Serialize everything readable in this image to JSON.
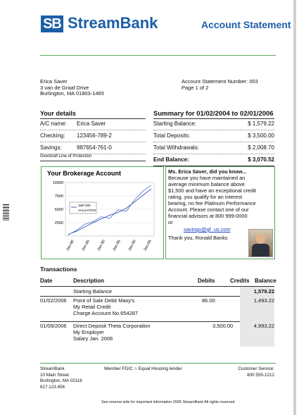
{
  "header": {
    "logo_mark": "SB",
    "logo_text": "StreamBank",
    "doc_title": "Account Statement"
  },
  "customer": {
    "name": "Erica Saver",
    "address1": "3 van de Graaf Drive",
    "address2": "Burlington, MA 01803-1465"
  },
  "statement": {
    "number_label": "Account Statement Number:",
    "number": "003",
    "page": "Page 1 of 2"
  },
  "details": {
    "title": "Your details",
    "rows": [
      {
        "label": "A/C name:",
        "value": "Erica Saver"
      },
      {
        "label": "Checking:",
        "value": "123456-789-2"
      },
      {
        "label": "Savings:",
        "value": "987654-761-0"
      }
    ],
    "overdraft": "Overdraft Line of Protection"
  },
  "summary": {
    "title": "Summary for 01/02/2004 to 02/01/2006",
    "rows": [
      {
        "label": "Starting Balance:",
        "value": "$ 1,579.22"
      },
      {
        "label": "Total Deposits:",
        "value": "$ 3,500.00"
      },
      {
        "label": "Total Withdrawals:",
        "value": "$ 2,008.70"
      }
    ],
    "end_label": "End Balance:",
    "end_value": "$ 3,070.52"
  },
  "chart_data": {
    "type": "line",
    "title": "Your Brokerage Account",
    "legend": [
      "S&P 500",
      "VALUATION"
    ],
    "ylim": [
      0,
      10000
    ],
    "yticks": [
      "10000",
      "7500",
      "5000",
      "2500"
    ],
    "xticks": [
      "Jan-80",
      "Jan-85",
      "Jan-90",
      "Jan-95",
      "Jan-00",
      "Jan-05"
    ],
    "series": [
      {
        "name": "S&P 500",
        "values": [
          300,
          900,
          1700,
          2500,
          3200,
          3900,
          4400,
          5200,
          6400,
          7600,
          8800
        ]
      },
      {
        "name": "VALUATION",
        "values": [
          200,
          1100,
          2200,
          2700,
          3600,
          3300,
          4900,
          4600,
          6800,
          8400,
          9500
        ]
      }
    ]
  },
  "promo": {
    "title": "Ms. Erica Saver, did you know...",
    "lines": [
      "Because you have maintained an",
      "average minimum balance above",
      "$1,500 and have an exceptional credit",
      "rating, you qualify for an interest",
      "bearing, no fee Platinum Performance",
      "Account. Please contact one of our",
      "financial advisors at 800 999-0000",
      "or"
    ],
    "email": "savings@gf_us.com",
    "thanks": "Thank you, Ronald Banks"
  },
  "transactions": {
    "title": "Transactions",
    "headers": {
      "date": "Date",
      "desc": "Description",
      "debits": "Debits",
      "credits": "Credits",
      "balance": "Balance"
    },
    "rows": [
      {
        "date": "",
        "desc": [
          "Starting Balance"
        ],
        "debits": "",
        "credits": "",
        "balance": "1,579.22",
        "bold": true
      },
      {
        "date": "01/02/2006",
        "desc": [
          "Point of Sale Debit Maxy's",
          "My Retail Credit",
          "Charge Account No.654287"
        ],
        "debits": "86.00",
        "credits": "",
        "balance": "1,493.22"
      },
      {
        "date": "01/09/2006",
        "desc": [
          "Direct Deposit Theta Corporation",
          "My Employer",
          "Salary  Jan. 2006"
        ],
        "debits": "",
        "credits": "3,500.00",
        "balance": "4,993.22"
      }
    ]
  },
  "footer": {
    "bank": "StreamBank",
    "addr1": "10 Main Street",
    "addr2": "Burlington, MA 02116",
    "phone": "617.123.456",
    "fdic": "Member FDIC",
    "lender": "Equal  Housing lender",
    "service_label": "Customer Service:",
    "service_phone": "800 555-1212",
    "note": "See reserve side for important information 2006 StreamBank All rights reserved"
  }
}
